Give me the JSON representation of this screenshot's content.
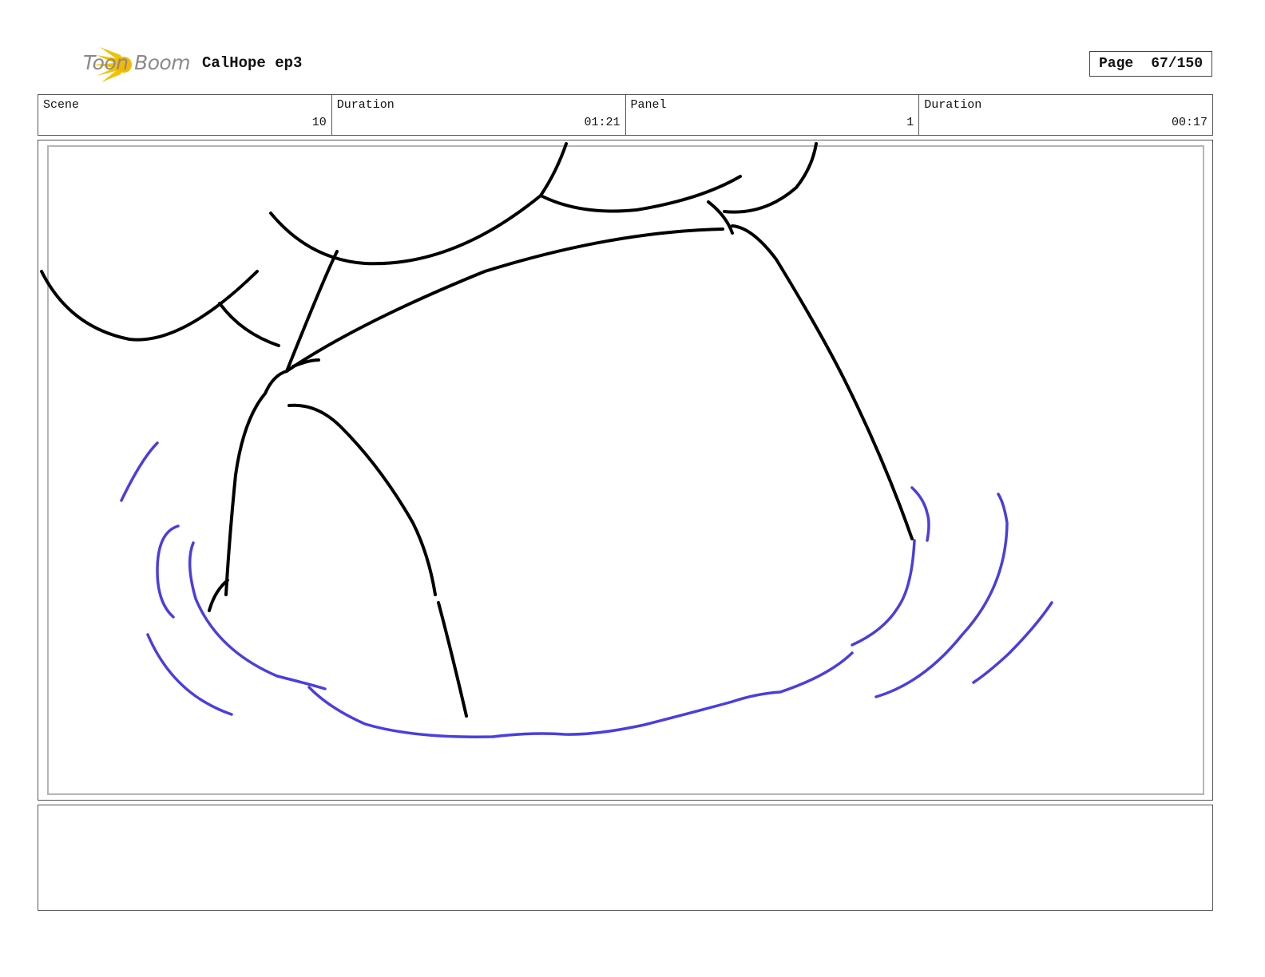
{
  "header": {
    "logo_text": "Toon Boom",
    "title": "CalHope ep3",
    "page_label": "Page",
    "page_value": "67/150"
  },
  "info": {
    "scene_label": "Scene",
    "scene_value": "10",
    "scene_duration_label": "Duration",
    "scene_duration_value": "01:21",
    "panel_label": "Panel",
    "panel_value": "1",
    "panel_duration_label": "Duration",
    "panel_duration_value": "00:17"
  },
  "colors": {
    "logo_yellow": "#f2c200",
    "ink_black": "#000000",
    "ink_blue": "#4a3ee0"
  },
  "notes": {
    "text": ""
  }
}
